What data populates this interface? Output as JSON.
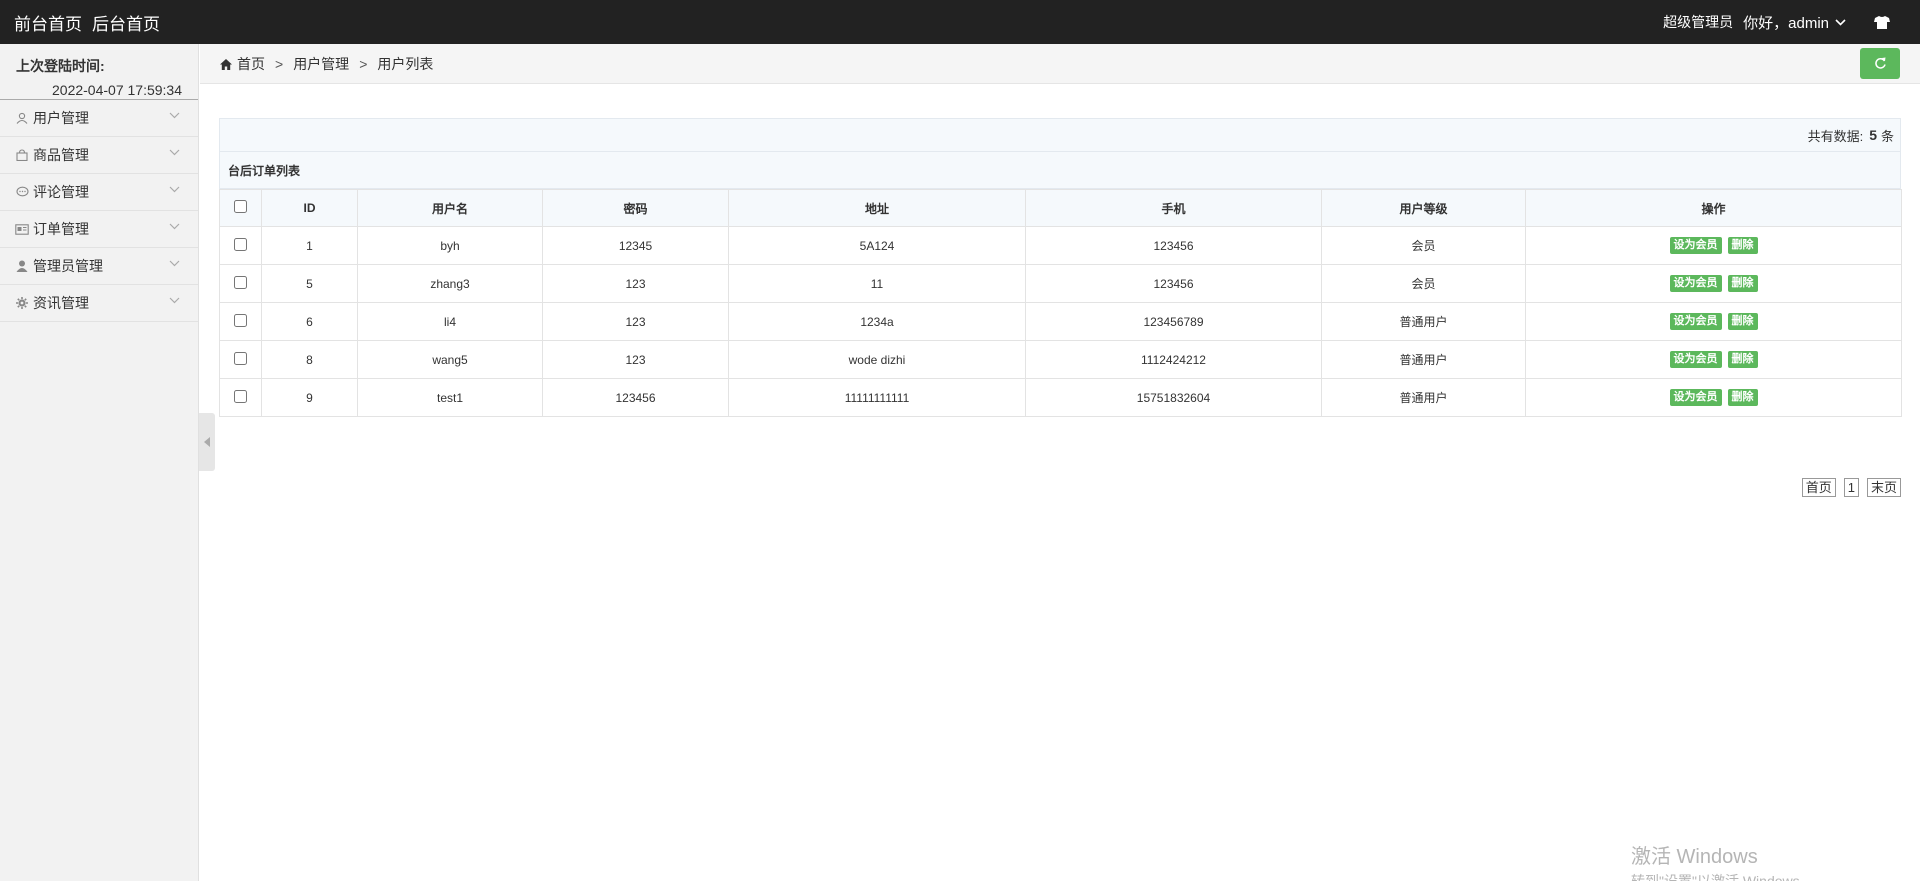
{
  "topbar": {
    "front_home": "前台首页",
    "back_home": "后台首页",
    "role": "超级管理员",
    "greeting": "你好，admin"
  },
  "sidebar": {
    "login_label": "上次登陆时间:",
    "login_time": "2022-04-07 17:59:34",
    "items": [
      {
        "label": "用户管理",
        "icon": "user-icon"
      },
      {
        "label": "商品管理",
        "icon": "shopping-bag-icon"
      },
      {
        "label": "评论管理",
        "icon": "comment-icon"
      },
      {
        "label": "订单管理",
        "icon": "order-icon"
      },
      {
        "label": "管理员管理",
        "icon": "admin-user-icon"
      },
      {
        "label": "资讯管理",
        "icon": "gear-icon"
      }
    ]
  },
  "breadcrumb": {
    "home": "首页",
    "sep": ">",
    "level1": "用户管理",
    "level2": "用户列表"
  },
  "summary": {
    "prefix": "共有数据:",
    "count": "5",
    "suffix": "条"
  },
  "table": {
    "title": "台后订单列表",
    "headers": [
      "ID",
      "用户名",
      "密码",
      "地址",
      "手机",
      "用户等级",
      "操作"
    ],
    "rows": [
      [
        "1",
        "byh",
        "12345",
        "5A124",
        "123456",
        "会员"
      ],
      [
        "5",
        "zhang3",
        "123",
        "11",
        "123456",
        "会员"
      ],
      [
        "6",
        "li4",
        "123",
        "1234a",
        "123456789",
        "普通用户"
      ],
      [
        "8",
        "wang5",
        "123",
        "wode dizhi",
        "1112424212",
        "普通用户"
      ],
      [
        "9",
        "test1",
        "123456",
        "11111111111",
        "15751832604",
        "普通用户"
      ]
    ],
    "btn_member": "设为会员",
    "btn_delete": "删除"
  },
  "pager": {
    "first": "首页",
    "page": "1",
    "last": "末页"
  },
  "watermark": {
    "line1": "激活 Windows",
    "line2": "转到\"设置\"以激活 Windows"
  },
  "colors": {
    "topbar": "#222222",
    "accent_green": "#5cb85c"
  }
}
